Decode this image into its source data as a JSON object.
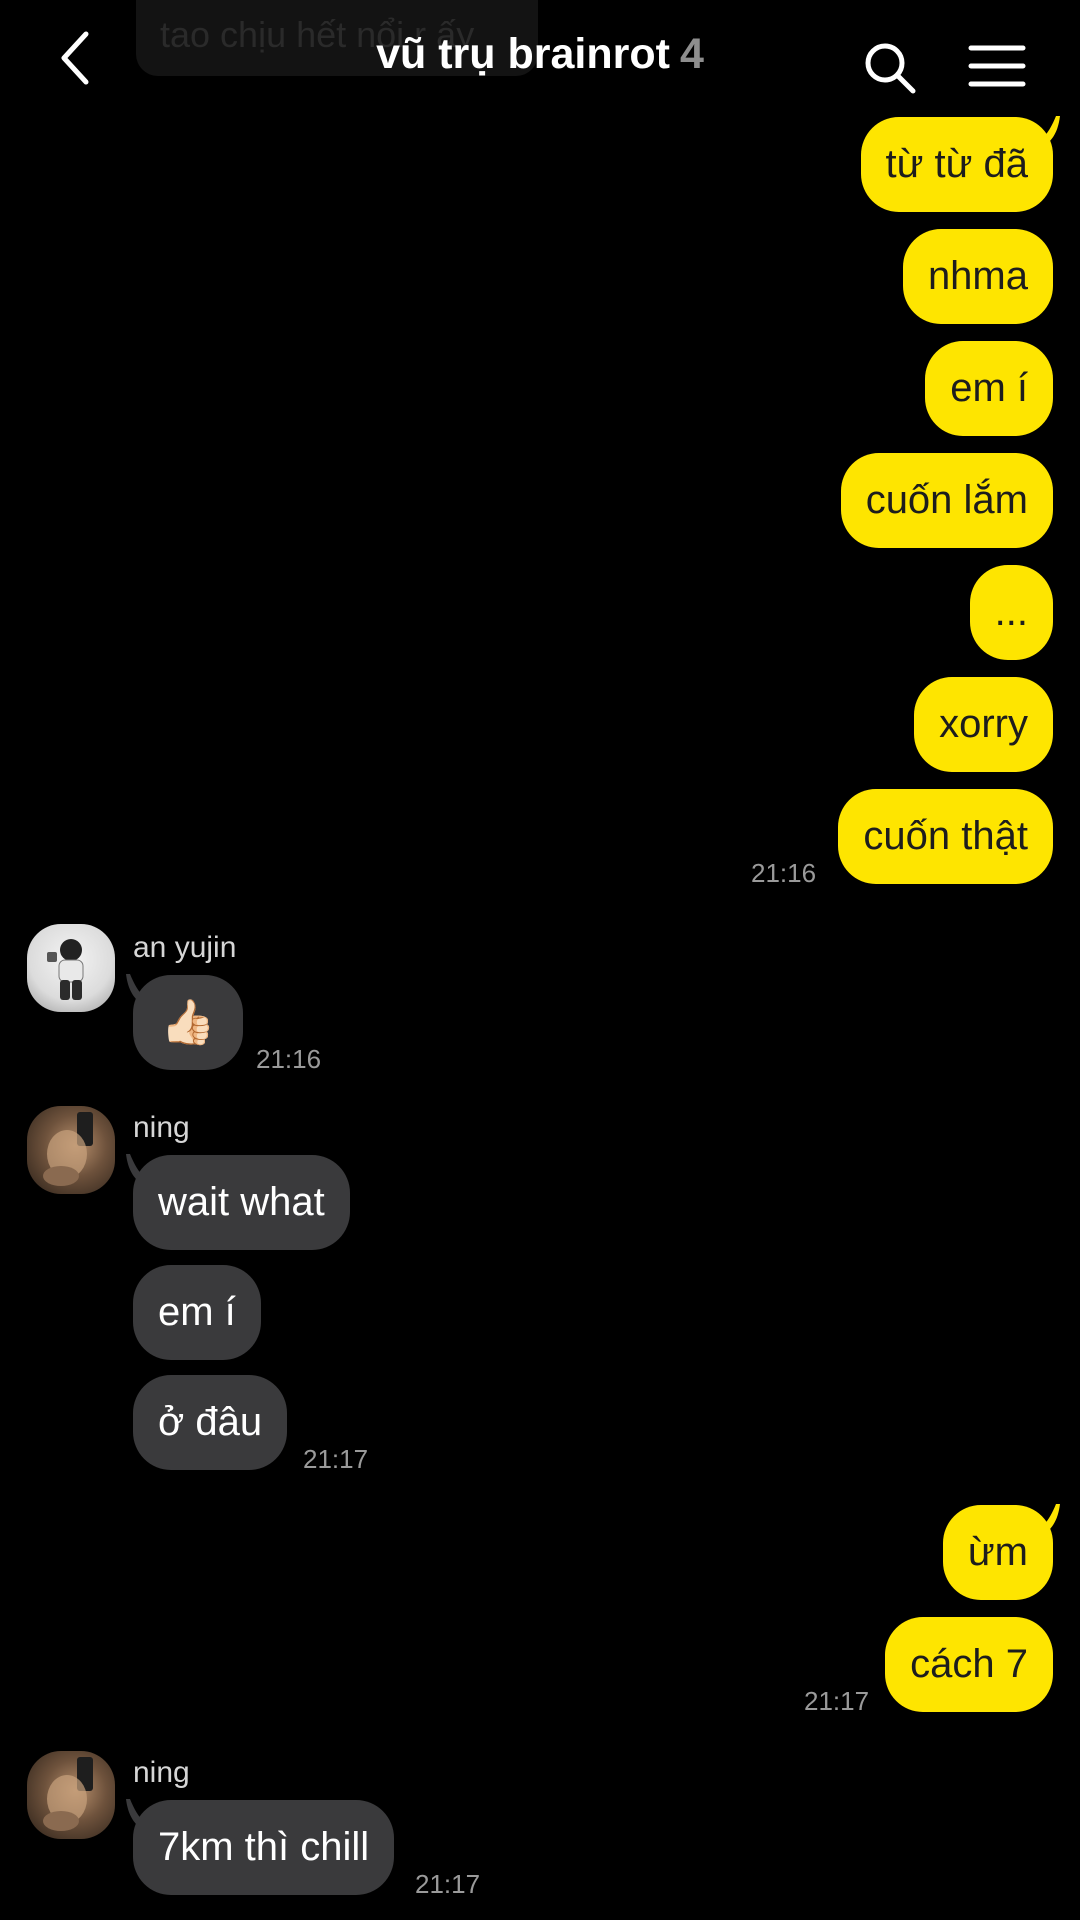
{
  "ghost_preview": "tao chịu hết nổi r ấy",
  "header": {
    "title": "vũ trụ brainrot",
    "member_count": "4",
    "icons": [
      "chevron-left-icon",
      "search-icon",
      "hamburger-menu-icon"
    ]
  },
  "colors": {
    "background": "#000000",
    "my_bubble": "#fee500",
    "their_bubble": "#3a3a3c",
    "timestamp": "#9a9a9a"
  },
  "messages": {
    "m1": "từ từ đã",
    "m2": "nhma",
    "m3": "em í",
    "m4": "cuốn lắm",
    "m5": "...",
    "m6": "xorry",
    "m7": "cuốn thật",
    "t1": "21:16",
    "sender_anyujin": "an yujin",
    "m8": "👍🏻",
    "t2": "21:16",
    "sender_ning1": "ning",
    "m9": "wait what",
    "m10": "em í",
    "m11": "ở đâu",
    "t3": "21:17",
    "m12": "ừm",
    "m13": "cách 7",
    "t4": "21:17",
    "sender_ning2": "ning",
    "m14": "7km thì chill",
    "t5": "21:17"
  }
}
